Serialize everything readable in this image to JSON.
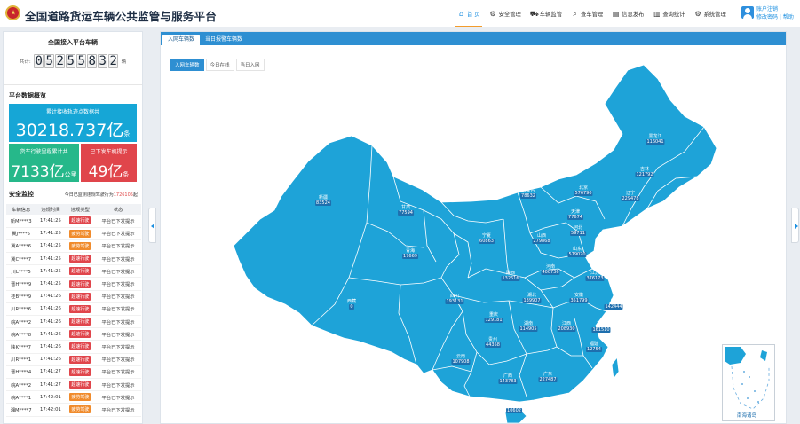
{
  "header": {
    "title": "全国道路货运车辆公共监管与服务平台",
    "nav": [
      {
        "label": "首 页",
        "icon": "home-icon",
        "glyph": "⌂",
        "active": true
      },
      {
        "label": "安全管理",
        "icon": "shield-gear-icon",
        "glyph": "⚙",
        "active": false
      },
      {
        "label": "车辆监管",
        "icon": "truck-icon",
        "glyph": "⛟",
        "active": false
      },
      {
        "label": "查车管理",
        "icon": "search-icon",
        "glyph": "⌕",
        "active": false
      },
      {
        "label": "信息发布",
        "icon": "document-icon",
        "glyph": "▤",
        "active": false
      },
      {
        "label": "查询统计",
        "icon": "chart-icon",
        "glyph": "▥",
        "active": false
      },
      {
        "label": "系统管理",
        "icon": "gear-icon",
        "glyph": "⚙",
        "active": false
      }
    ],
    "user": {
      "line1": "账户注销",
      "line2": "修改密码 | 帮助"
    }
  },
  "left": {
    "counter": {
      "title": "全国接入平台车辆",
      "prefix": "共计:",
      "digits": [
        "0",
        "5",
        "2",
        "5",
        "5",
        "8",
        "3",
        "2"
      ],
      "suffix": "辆"
    },
    "overview": {
      "title": "平台数据概览",
      "track_label": "累计接收轨迹点数据共",
      "track_value": "30218.737",
      "track_unit_big": "亿",
      "track_unit_small": "条",
      "mileage_label": "货车行驶里程累计共",
      "mileage_value": "7133",
      "mileage_unit_big": "亿",
      "mileage_unit_small": "公里",
      "alerts_label": "已下发车机提示",
      "alerts_value": "49",
      "alerts_unit_big": "亿",
      "alerts_unit_small": "条"
    },
    "monitor": {
      "title": "安全监控",
      "note_pre": "今日已监测违规驾驶行为",
      "note_num": "1726105",
      "note_post": "起",
      "columns": [
        "车辆信息",
        "违规时间",
        "违规类型",
        "状态"
      ],
      "rows": [
        {
          "plate": "新M****3",
          "time": "17:41:25",
          "type": "超速行驶",
          "status": "平台已下发提示",
          "color": "#e0454b"
        },
        {
          "plate": "冀J****5",
          "time": "17:41:25",
          "type": "疲劳驾驶",
          "status": "平台已下发提示",
          "color": "#f08b2c"
        },
        {
          "plate": "冀A****6",
          "time": "17:41:25",
          "type": "疲劳驾驶",
          "status": "平台已下发提示",
          "color": "#f08b2c"
        },
        {
          "plate": "冀C****7",
          "time": "17:41:25",
          "type": "超速行驶",
          "status": "平台已下发提示",
          "color": "#e0454b"
        },
        {
          "plate": "川L****5",
          "time": "17:41:25",
          "type": "超速行驶",
          "status": "平台已下发提示",
          "color": "#e0454b"
        },
        {
          "plate": "晋H****9",
          "time": "17:41:25",
          "type": "超速行驶",
          "status": "平台已下发提示",
          "color": "#e0454b"
        },
        {
          "plate": "桂B****9",
          "time": "17:41:26",
          "type": "超速行驶",
          "status": "平台已下发提示",
          "color": "#e0454b"
        },
        {
          "plate": "川R****6",
          "time": "17:41:26",
          "type": "超速行驶",
          "status": "平台已下发提示",
          "color": "#e0454b"
        },
        {
          "plate": "皖A****2",
          "time": "17:41:26",
          "type": "超速行驶",
          "status": "平台已下发提示",
          "color": "#e0454b"
        },
        {
          "plate": "皖A****8",
          "time": "17:41:26",
          "type": "超速行驶",
          "status": "平台已下发提示",
          "color": "#e0454b"
        },
        {
          "plate": "陕K****7",
          "time": "17:41:26",
          "type": "超速行驶",
          "status": "平台已下发提示",
          "color": "#e0454b"
        },
        {
          "plate": "川R****1",
          "time": "17:41:26",
          "type": "超速行驶",
          "status": "平台已下发提示",
          "color": "#e0454b"
        },
        {
          "plate": "晋H****4",
          "time": "17:41:27",
          "type": "超速行驶",
          "status": "平台已下发提示",
          "color": "#e0454b"
        },
        {
          "plate": "皖A****2",
          "time": "17:41:27",
          "type": "超速行驶",
          "status": "平台已下发提示",
          "color": "#e0454b"
        },
        {
          "plate": "皖A****1",
          "time": "17:42:01",
          "type": "疲劳驾驶",
          "status": "平台已下发提示",
          "color": "#f08b2c"
        },
        {
          "plate": "湘M****7",
          "time": "17:42:01",
          "type": "疲劳驾驶",
          "status": "平台已下发提示",
          "color": "#f08b2c"
        }
      ]
    }
  },
  "main": {
    "tabs": [
      "入网车辆数",
      "当日报警车辆数"
    ],
    "subtabs": [
      "入网车辆数",
      "今日在线",
      "当日入网"
    ],
    "map_color": "#1ea3d8",
    "provinces": [
      {
        "name": "新疆",
        "value": "83524"
      },
      {
        "name": "西藏",
        "value": "0"
      },
      {
        "name": "青海",
        "value": "17669"
      },
      {
        "name": "甘肃",
        "value": "77594"
      },
      {
        "name": "内蒙古",
        "value": "78632"
      },
      {
        "name": "黑龙江",
        "value": "116041"
      },
      {
        "name": "吉林",
        "value": "121792"
      },
      {
        "name": "辽宁",
        "value": "229478"
      },
      {
        "name": "北京",
        "value": "576790"
      },
      {
        "name": "天津",
        "value": "77674"
      },
      {
        "name": "河北",
        "value": "59711"
      },
      {
        "name": "宁夏",
        "value": "60863"
      },
      {
        "name": "山西",
        "value": "279868"
      },
      {
        "name": "山东",
        "value": "579070"
      },
      {
        "name": "陕西",
        "value": "132616"
      },
      {
        "name": "河南",
        "value": "400736"
      },
      {
        "name": "江苏",
        "value": "376173"
      },
      {
        "name": "四川",
        "value": "193131"
      },
      {
        "name": "湖北",
        "value": "139907"
      },
      {
        "name": "安徽",
        "value": "351799"
      },
      {
        "name": "上海",
        "value": "142444"
      },
      {
        "name": "重庆",
        "value": "129181"
      },
      {
        "name": "湖南",
        "value": "114905"
      },
      {
        "name": "江西",
        "value": "208930"
      },
      {
        "name": "浙江",
        "value": "161510"
      },
      {
        "name": "贵州",
        "value": "44358"
      },
      {
        "name": "福建",
        "value": "12754"
      },
      {
        "name": "云南",
        "value": "107908"
      },
      {
        "name": "广西",
        "value": "143783"
      },
      {
        "name": "广东",
        "value": "227487"
      },
      {
        "name": "海南",
        "value": "10602"
      }
    ],
    "inset_label": "南海诸岛"
  }
}
